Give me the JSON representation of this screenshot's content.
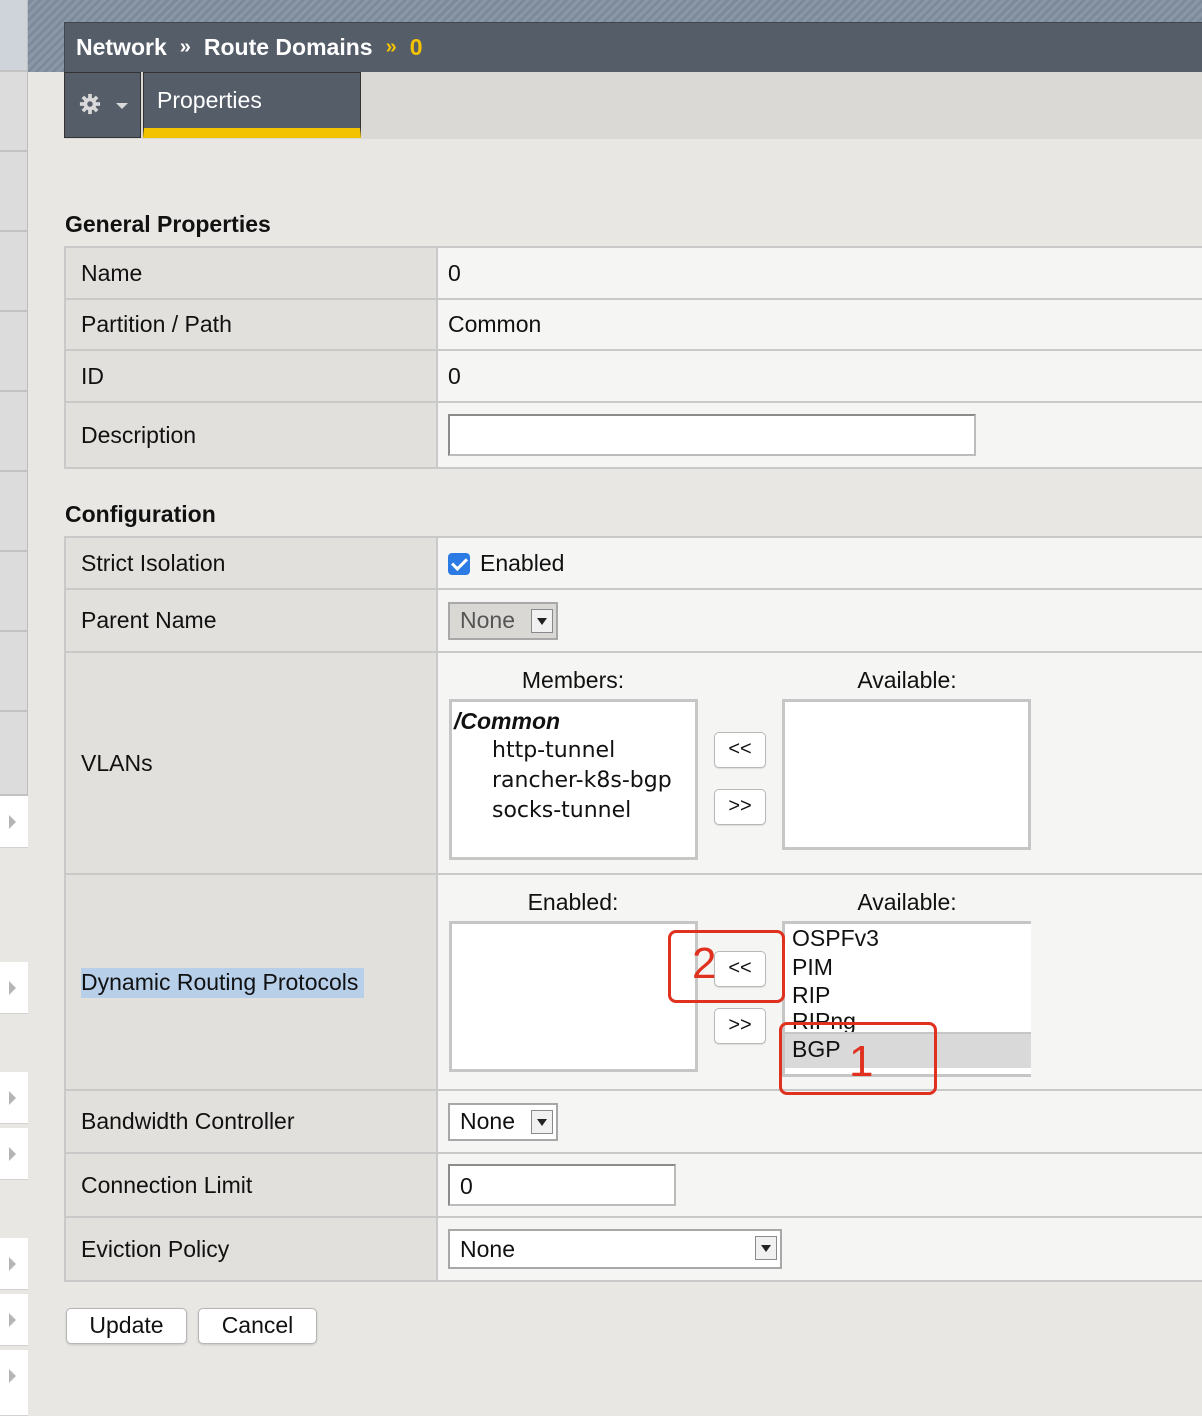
{
  "breadcrumb": {
    "item1": "Network",
    "sep1": "»",
    "item2": "Route Domains",
    "sep2": "»",
    "item3": "0"
  },
  "tabs": {
    "gear_icon": "gear-icon",
    "properties_label": "Properties"
  },
  "general": {
    "title": "General Properties",
    "rows": {
      "name": {
        "label": "Name",
        "value": "0"
      },
      "partition": {
        "label": "Partition / Path",
        "value": "Common"
      },
      "id": {
        "label": "ID",
        "value": "0"
      },
      "description": {
        "label": "Description",
        "value": ""
      }
    }
  },
  "configuration": {
    "title": "Configuration",
    "strict_isolation": {
      "label": "Strict Isolation",
      "checked": true,
      "checkbox_label": "Enabled"
    },
    "parent_name": {
      "label": "Parent Name",
      "value": "None"
    },
    "vlans": {
      "label": "VLANs",
      "members_header": "Members:",
      "available_header": "Available:",
      "members_group": "/Common",
      "members": [
        "http-tunnel",
        "rancher-k8s-bgp",
        "socks-tunnel"
      ],
      "available": [],
      "move_left": "<<",
      "move_right": ">>"
    },
    "routing": {
      "label": "Dynamic Routing Protocols",
      "enabled_header": "Enabled:",
      "available_header": "Available:",
      "enabled": [],
      "available": [
        "OSPFv3",
        "PIM",
        "RIP",
        "RIPng",
        "BGP"
      ],
      "selected": "BGP",
      "move_left": "<<",
      "move_right": ">>",
      "annotation_1": "1",
      "annotation_2": "2",
      "annotation_color": "#e0301e"
    },
    "bandwidth": {
      "label": "Bandwidth Controller",
      "value": "None"
    },
    "connection_limit": {
      "label": "Connection Limit",
      "value": "0"
    },
    "eviction": {
      "label": "Eviction Policy",
      "value": "None"
    }
  },
  "buttons": {
    "update": "Update",
    "cancel": "Cancel"
  },
  "colors": {
    "header_bg": "#545d68",
    "accent": "#f4c300",
    "checkbox": "#2c7be5"
  }
}
